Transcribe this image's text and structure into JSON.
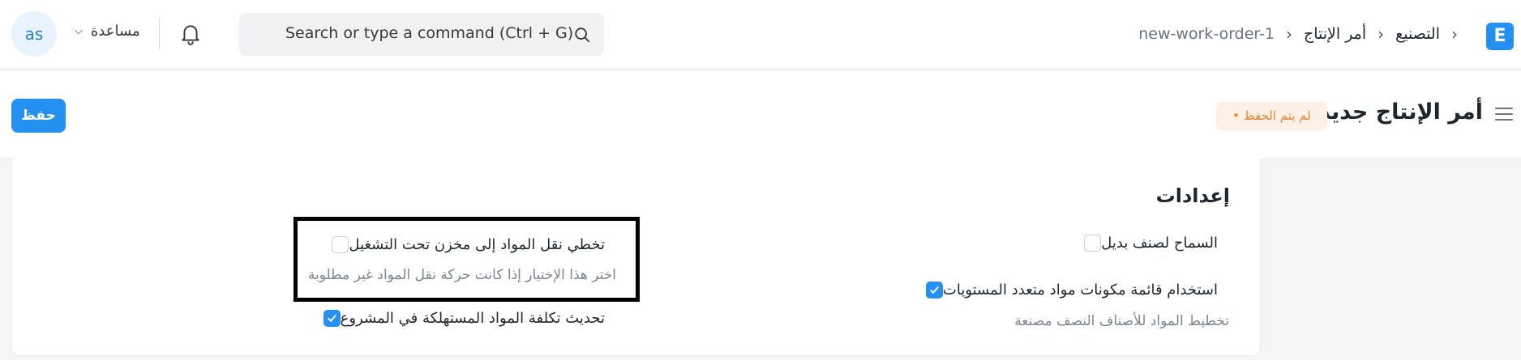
{
  "navbar": {
    "logo_letter": "E",
    "breadcrumbs": [
      "التصنيع",
      "أمر الإنتاج",
      "new-work-order-1"
    ],
    "separator": "›",
    "search_placeholder": "Search or type a command (Ctrl + G)",
    "help_label": "مساعدة",
    "avatar_initials": "as"
  },
  "page": {
    "title": "أمر الإنتاج جديد",
    "status": "• لم يتم الحفظ",
    "save_label": "حفظ"
  },
  "settings": {
    "title": "إعدادات",
    "fields": [
      {
        "label": "السماح لصنف بديل",
        "checked": false
      },
      {
        "label": "استخدام قائمة مكونات مواد متعدد المستويات",
        "checked": true,
        "description": "تخطيط المواد للأصناف النصف مصنعة"
      },
      {
        "label": "تخطي نقل المواد إلى مخزن تحت التشغيل",
        "checked": false,
        "description": "اختر هذا الإختيار إذا كانت حركة نقل المواد غير مطلوبة"
      },
      {
        "label": "تحديث تكلفة المواد المستهلكة في المشروع",
        "checked": true
      }
    ]
  },
  "colors": {
    "primary": "#2490ef",
    "status_text": "#e4862d",
    "status_bg": "#fdf0e6"
  }
}
